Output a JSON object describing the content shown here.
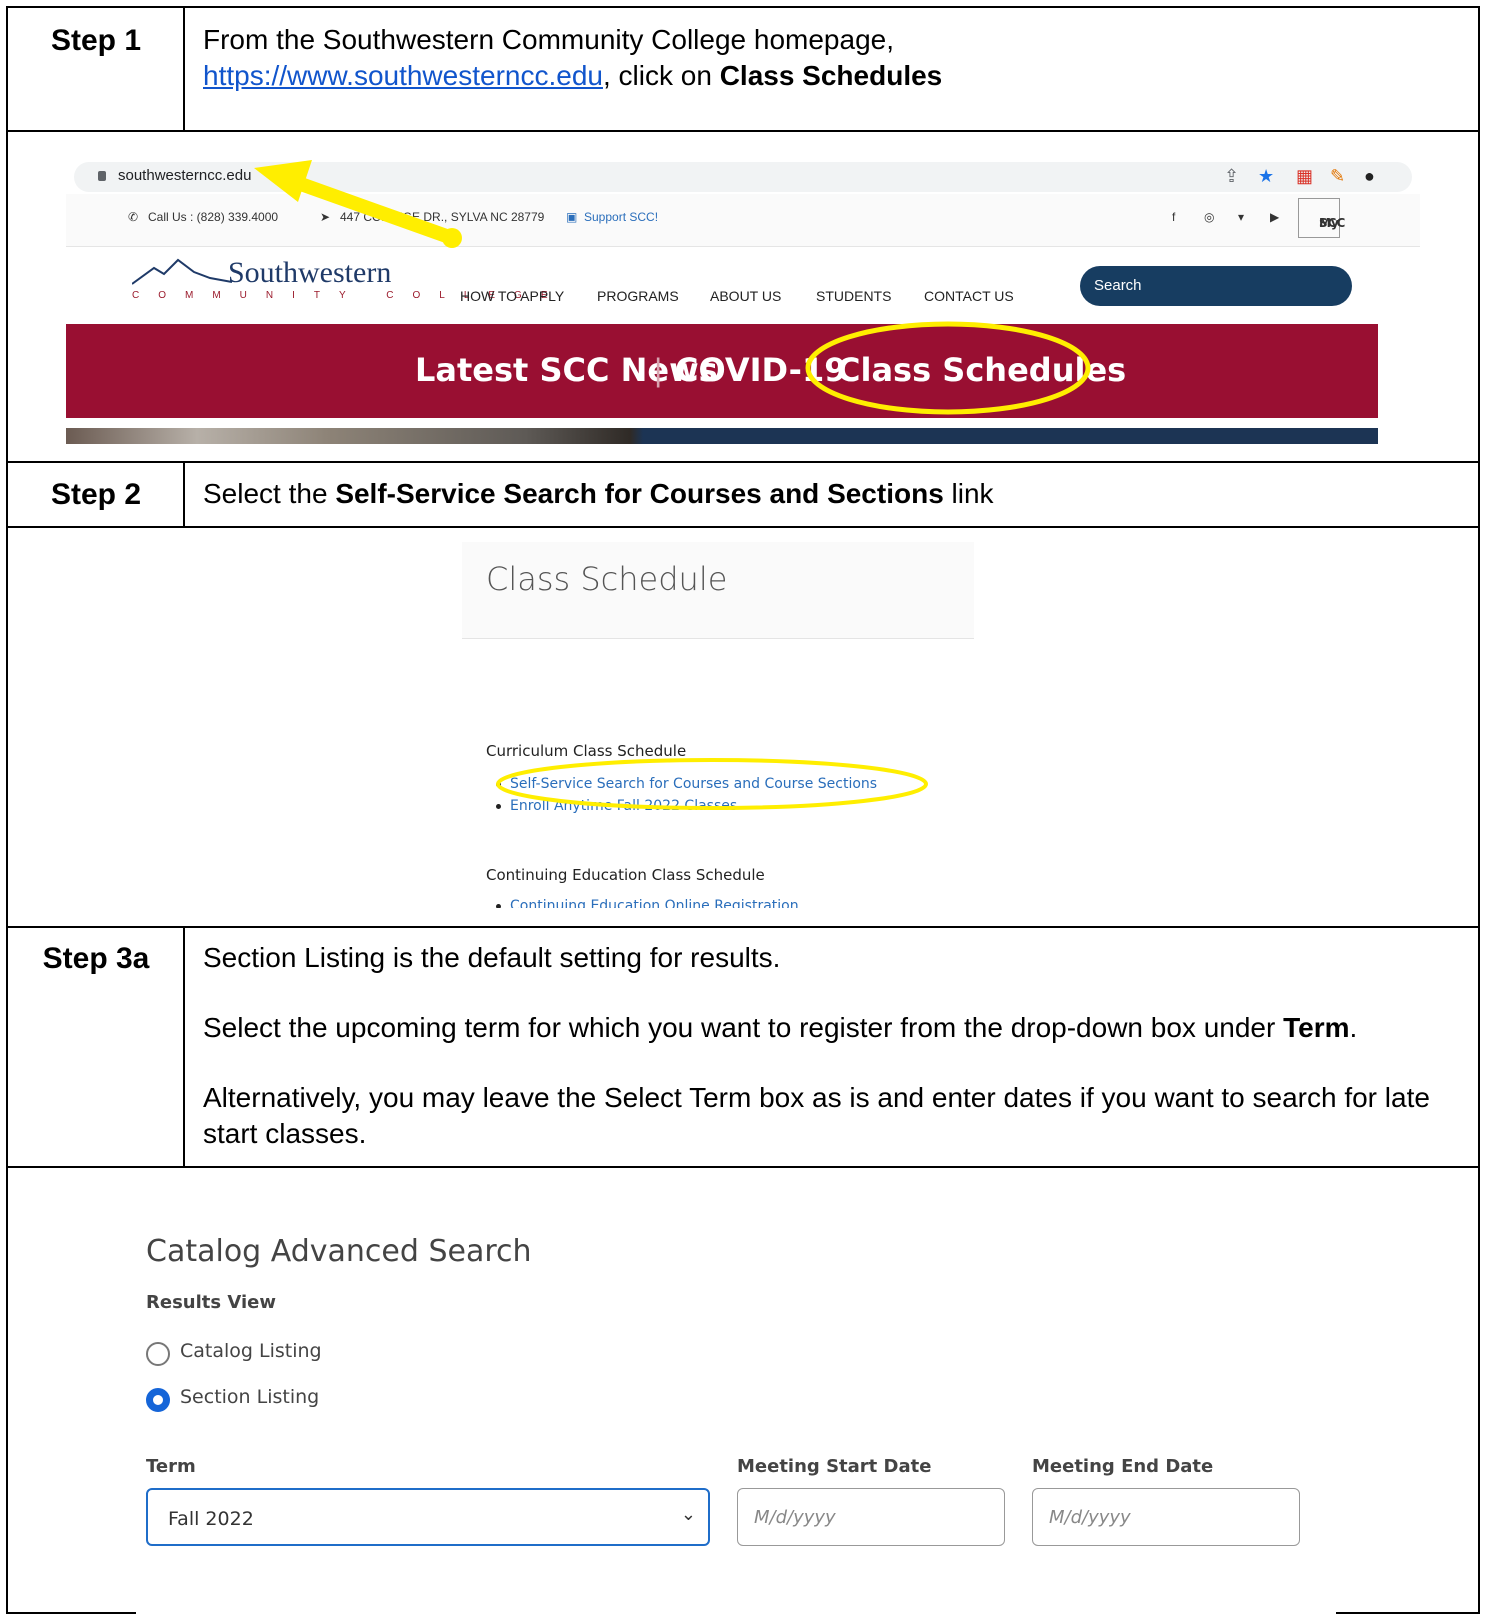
{
  "step1": {
    "label": "Step 1",
    "text_pre": "From the Southwestern Community College homepage,",
    "link": "https://www.southwesterncc.edu",
    "text_mid": ", click on ",
    "bold": "Class Schedules"
  },
  "screenshot1": {
    "address": "southwesterncc.edu",
    "call": "Call Us : (828) 339.4000",
    "address_line": "447 COLLEGE DR., SYLVA NC 28779",
    "support": "Support SCC!",
    "myscc_top": "My",
    "myscc_bottom": "SCC",
    "logo_word": "Southwestern",
    "logo_sub": "COMMUNITY COLLEGE",
    "nav": [
      "HOW TO APPLY",
      "PROGRAMS",
      "ABOUT US",
      "STUDENTS",
      "CONTACT US"
    ],
    "search": "Search",
    "banner": [
      "Latest SCC News",
      "COVID-19",
      "Class Schedules"
    ],
    "banner_sep": "|",
    "highlight_color": "#ffee00",
    "banner_color": "#990f32"
  },
  "step2": {
    "label": "Step 2",
    "text_pre": "Select the ",
    "bold": "Self-Service Search for Courses and Sections",
    "text_post": " link"
  },
  "screenshot2": {
    "title": "Class Schedule",
    "section1": "Curriculum Class Schedule",
    "links1": [
      "Self-Service Search for Courses and Course Sections",
      "Enroll Anytime Fall 2022 Classes"
    ],
    "section2": "Continuing Education Class Schedule",
    "links2": [
      "Continuing Education Online Registration"
    ]
  },
  "step3a": {
    "label": "Step 3a",
    "p1": "Section Listing is the default setting for results.",
    "p2_pre": "Select the upcoming term for which you want to register from the drop-down box under ",
    "p2_bold": "Term",
    "p2_post": ".",
    "p3": "Alternatively, you may leave the Select Term box as is and enter dates if you want to search for late start classes."
  },
  "screenshot3": {
    "title": "Catalog Advanced Search",
    "results_view": "Results View",
    "options": [
      "Catalog Listing",
      "Section Listing"
    ],
    "selected_option": "Section Listing",
    "term_label": "Term",
    "term_value": "Fall 2022",
    "start_label": "Meeting Start Date",
    "end_label": "Meeting End Date",
    "date_placeholder": "M/d/yyyy",
    "accent_color": "#1565d8"
  }
}
